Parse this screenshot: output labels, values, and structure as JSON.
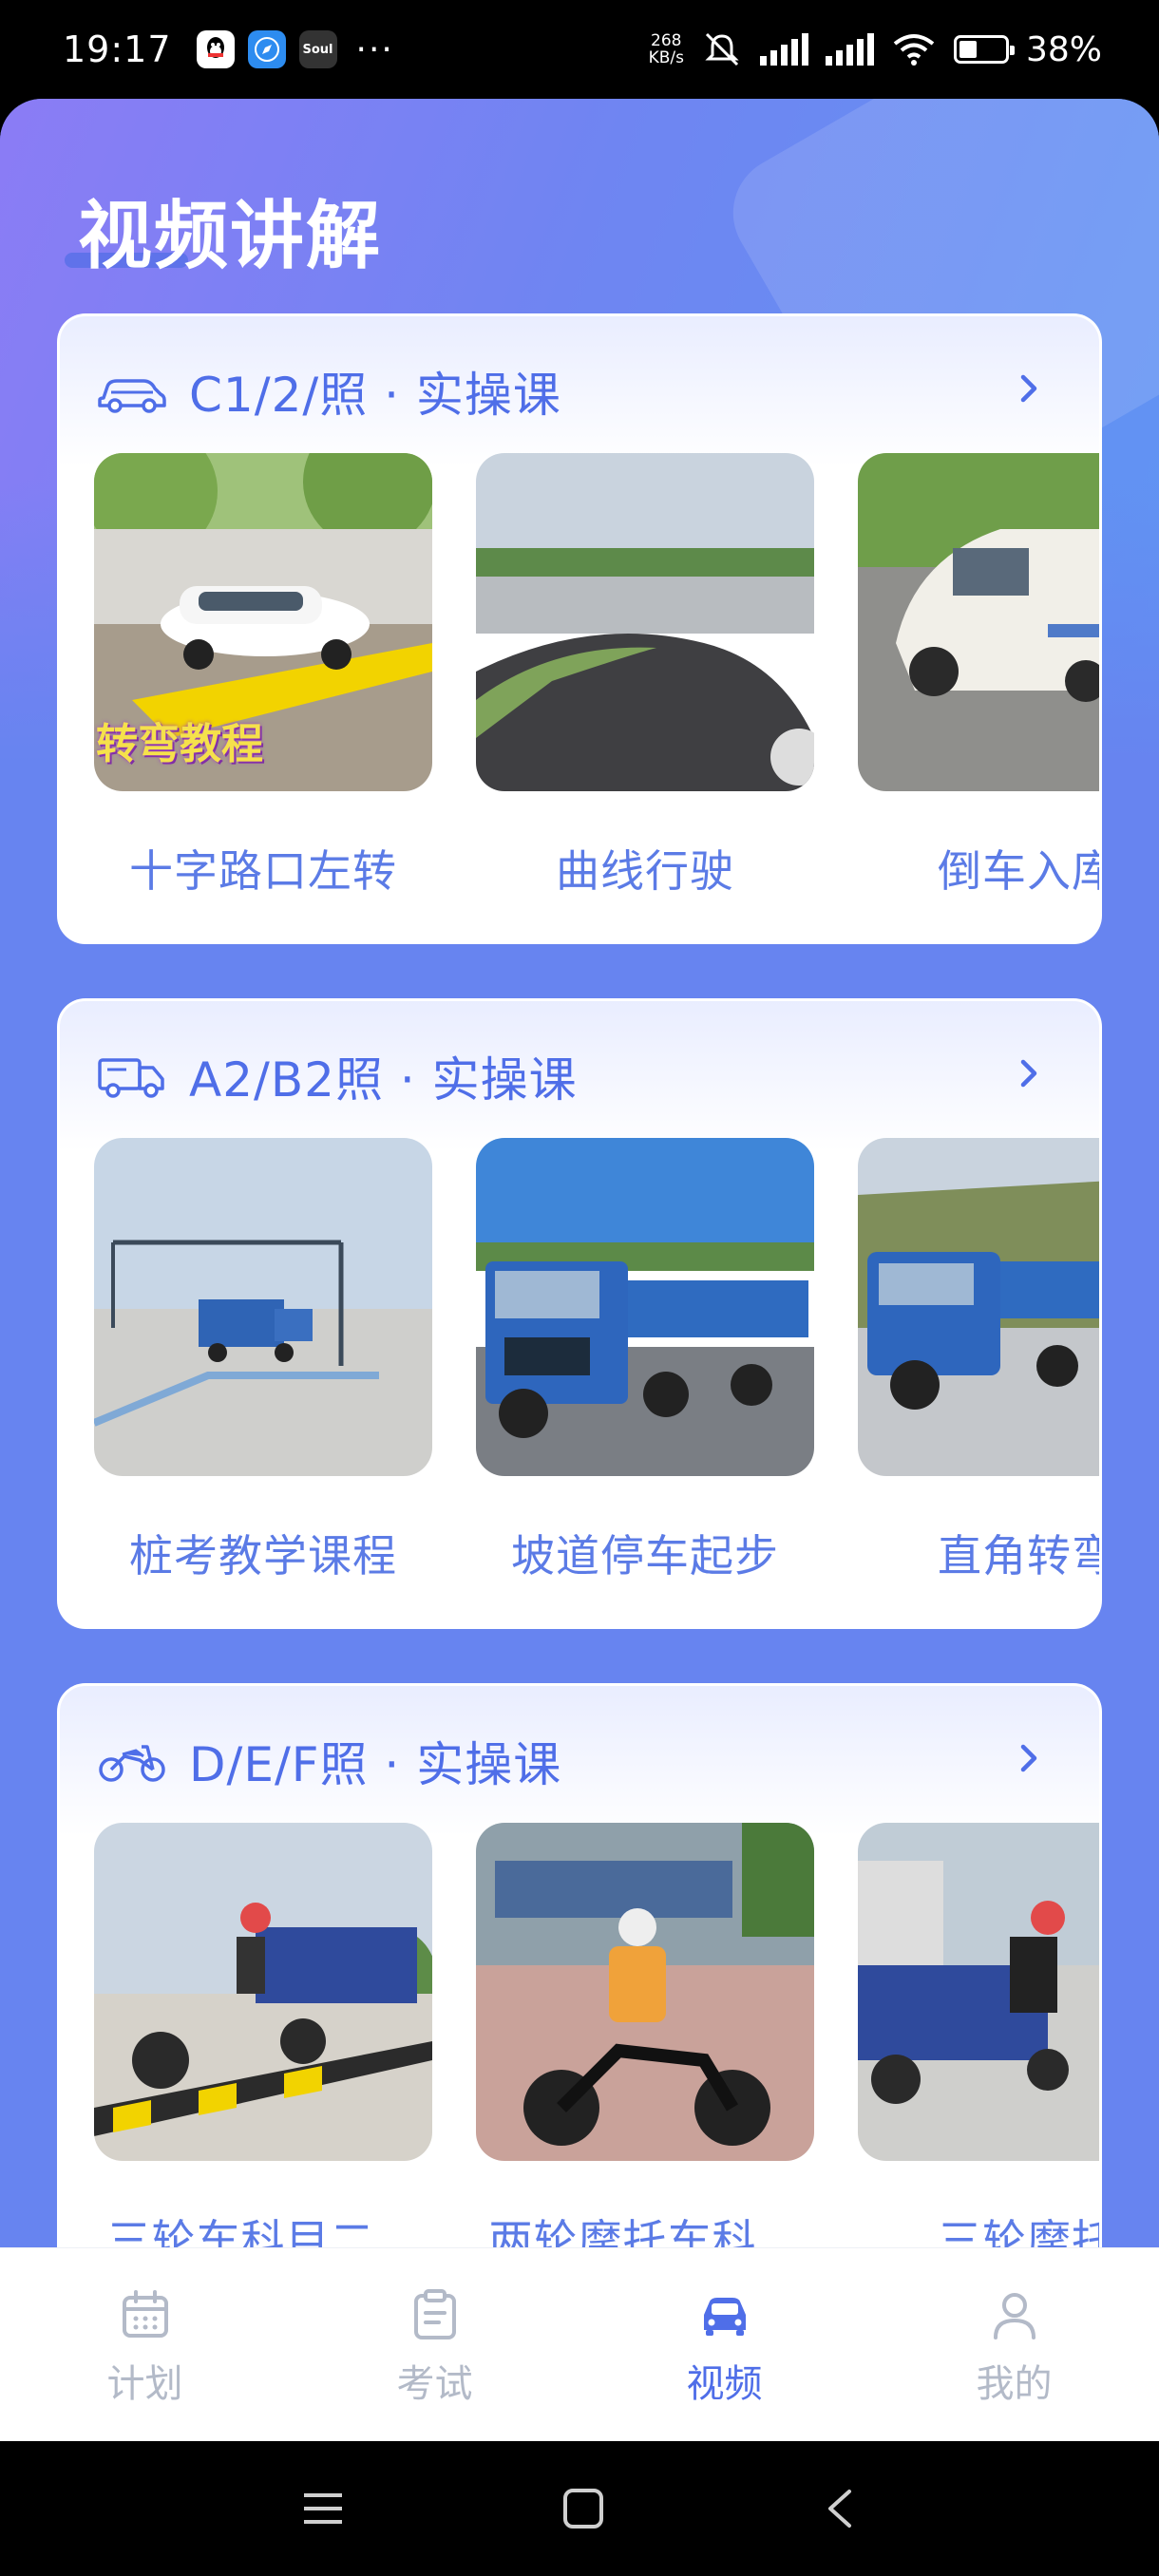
{
  "status_bar": {
    "time": "19:17",
    "net_speed_value": "268",
    "net_speed_unit": "KB/s",
    "battery": "38%",
    "app_icons": [
      "qq-icon",
      "browser-icon",
      "soul-icon"
    ],
    "soul_label": "Soul"
  },
  "page": {
    "title": "视频讲解"
  },
  "sections": [
    {
      "title": "C1/2/照 · 实操课",
      "icon": "car-icon",
      "videos": [
        {
          "label": "十字路口左转",
          "overlay": "转弯教程"
        },
        {
          "label": "曲线行驶"
        },
        {
          "label": "倒车入库"
        }
      ]
    },
    {
      "title": "A2/B2照 · 实操课",
      "icon": "truck-icon",
      "videos": [
        {
          "label": "桩考教学课程"
        },
        {
          "label": "坡道停车起步"
        },
        {
          "label": "直角转弯技"
        }
      ]
    },
    {
      "title": "D/E/F照 · 实操课",
      "icon": "motorcycle-icon",
      "videos": [
        {
          "label": "三轮车科目二…"
        },
        {
          "label": "两轮摩托车科…"
        },
        {
          "label": "三轮摩托科三"
        }
      ]
    }
  ],
  "bottom_nav": {
    "items": [
      {
        "label": "计划",
        "icon": "calendar-icon",
        "active": false
      },
      {
        "label": "考试",
        "icon": "clipboard-icon",
        "active": false
      },
      {
        "label": "视频",
        "icon": "car-icon",
        "active": true
      },
      {
        "label": "我的",
        "icon": "user-icon",
        "active": false
      }
    ]
  },
  "colors": {
    "accent": "#4f6ee8",
    "page_bg": "#6784f0",
    "inactive": "#b3bac8"
  }
}
